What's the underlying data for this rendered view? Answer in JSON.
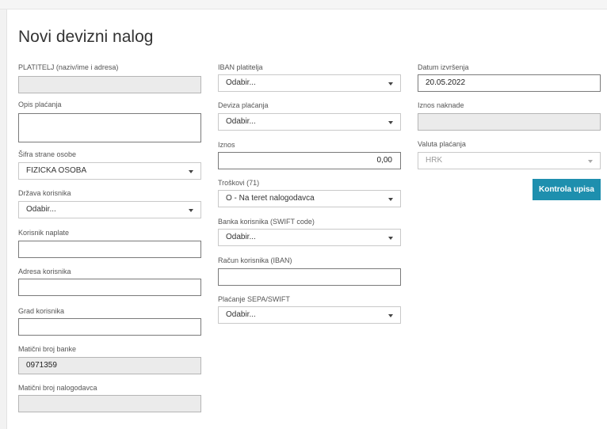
{
  "page": {
    "title": "Novi devizni nalog"
  },
  "col1": {
    "platitelj_label": "PLATITELJ (naziv/ime i adresa)",
    "platitelj_value": "",
    "opis_label": "Opis plaćanja",
    "opis_value": "",
    "sifra_label": "Šifra strane osobe",
    "sifra_value": "FIZICKA OSOBA",
    "drzava_label": "Država korisnika",
    "drzava_value": "Odabir...",
    "korisnik_label": "Korisnik naplate",
    "korisnik_value": "",
    "adresa_label": "Adresa korisnika",
    "adresa_value": "",
    "grad_label": "Grad korisnika",
    "grad_value": "",
    "mb_banke_label": "Matični broj banke",
    "mb_banke_value": "0971359",
    "mb_nalogodavca_label": "Matični broj nalogodavca",
    "mb_nalogodavca_value": ""
  },
  "col2": {
    "iban_label": "IBAN platitelja",
    "iban_value": "Odabir...",
    "deviza_label": "Deviza plaćanja",
    "deviza_value": "Odabir...",
    "iznos_label": "Iznos",
    "iznos_value": "0,00",
    "troskovi_label": "Troškovi (71)",
    "troskovi_value": "O - Na teret nalogodavca",
    "banka_label": "Banka korisnika (SWIFT code)",
    "banka_value": "Odabir...",
    "racun_label": "Račun korisnika (IBAN)",
    "racun_value": "",
    "placanje_label": "Plaćanje SEPA/SWIFT",
    "placanje_value": "Odabir..."
  },
  "col3": {
    "datum_label": "Datum izvršenja",
    "datum_value": "20.05.2022",
    "naknada_label": "Iznos naknade",
    "naknada_value": "",
    "valuta_label": "Valuta plaćanja",
    "valuta_value": "HRK",
    "button_label": "Kontrola upisa"
  },
  "colors": {
    "accent": "#1e8fae",
    "readonly_bg": "#ebebeb"
  }
}
